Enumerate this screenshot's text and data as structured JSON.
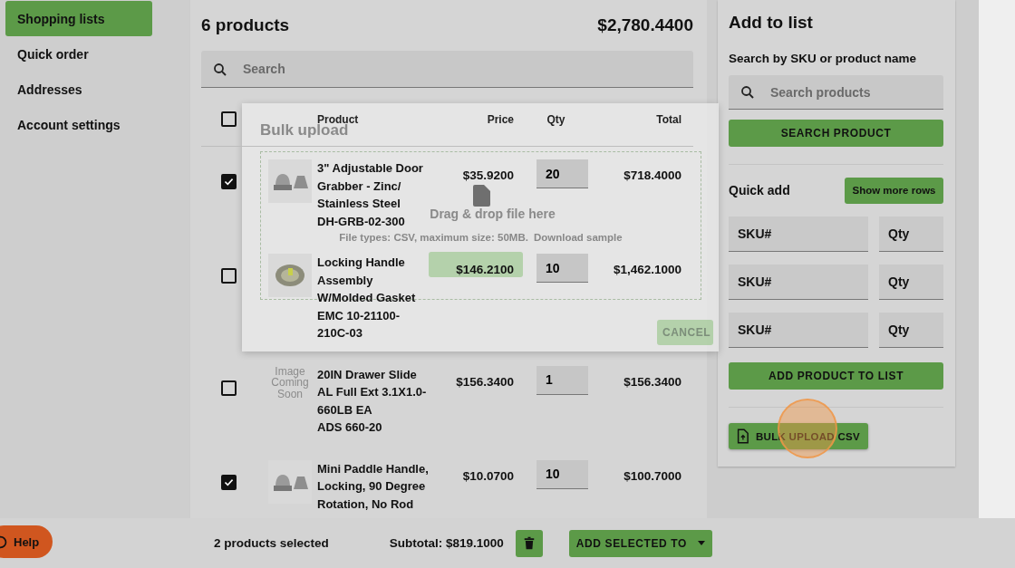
{
  "sidebar": {
    "items": [
      {
        "label": "Shopping lists",
        "selected": true
      },
      {
        "label": "Quick order",
        "selected": false
      },
      {
        "label": "Addresses",
        "selected": false
      },
      {
        "label": "Account settings",
        "selected": false
      }
    ]
  },
  "list": {
    "count": "6 products",
    "total": "$2,780.4400",
    "search": {
      "placeholder": "Search"
    },
    "columns": [
      "Product",
      "Price",
      "Qty",
      "Total"
    ],
    "all_checked": false,
    "rows": [
      {
        "checked": true,
        "name": "3\" Adjustable Door Grabber - Zinc/ Stainless Steel",
        "sku": "DH-GRB-02-300",
        "price": "$35.9200",
        "qty": "20",
        "total": "$718.4000"
      },
      {
        "checked": false,
        "name": "Locking Handle Assembly W/Molded Gasket",
        "sku": "EMC 10-21100-210C-03",
        "price": "$146.2100",
        "qty": "10",
        "total": "$1,462.1000"
      },
      {
        "checked": false,
        "image": {
          "kind": "placeholder",
          "text": "Image Coming Soon"
        },
        "name": "20IN Drawer Slide AL Full Ext 3.1X1.0-660LB EA",
        "sku": "ADS 660-20",
        "price": "$156.3400",
        "qty": "1",
        "total": "$156.3400"
      },
      {
        "checked": true,
        "name": "Mini Paddle Handle, Locking, 90 Degree Rotation, No Rod",
        "price": "$10.0700",
        "qty": "10",
        "total": "$100.7000"
      }
    ]
  },
  "dialog": {
    "title": "Bulk upload",
    "drop_text": "Drag & drop file here",
    "hint": "File types: CSV, maximum size: 50MB.",
    "sample_link": "Download sample",
    "cancel_button": "CANCEL"
  },
  "add_panel": {
    "title": "Add to list",
    "search_label": "Search by SKU or product name",
    "search": {
      "placeholder": "Search products"
    },
    "search_button": "SEARCH PRODUCT",
    "quick_add": {
      "title": "Quick add",
      "more_button": "Show more rows",
      "rows": [
        {
          "sku_placeholder": "SKU#",
          "qty_placeholder": "Qty"
        },
        {
          "sku_placeholder": "SKU#",
          "qty_placeholder": "Qty"
        },
        {
          "sku_placeholder": "SKU#",
          "qty_placeholder": "Qty"
        }
      ]
    },
    "add_button": "ADD PRODUCT TO LIST",
    "bulk_button": "BULK UPLOAD CSV"
  },
  "footer": {
    "help": "Help",
    "selected": "2 products selected",
    "subtotal": "Subtotal: $819.1000",
    "add_selected": "ADD SELECTED TO"
  }
}
